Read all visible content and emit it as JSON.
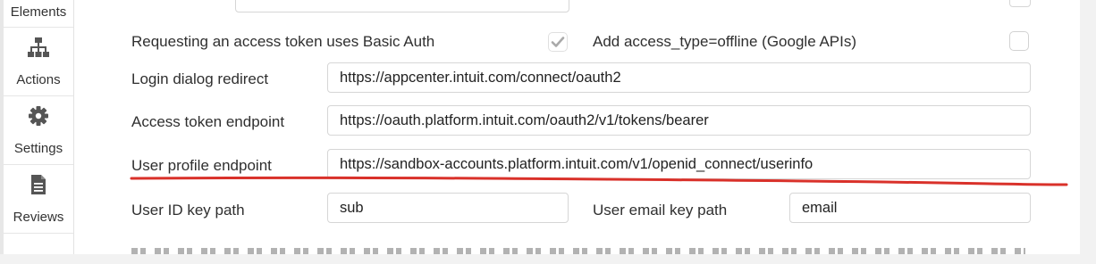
{
  "sidebar": {
    "items": [
      {
        "label": "Elements",
        "icon": "elements-icon"
      },
      {
        "label": "Actions",
        "icon": "sitemap-icon"
      },
      {
        "label": "Settings",
        "icon": "gear-icon"
      },
      {
        "label": "Reviews",
        "icon": "document-icon"
      }
    ]
  },
  "form": {
    "basic_auth_label": "Requesting an access token uses Basic Auth",
    "basic_auth_checked": true,
    "offline_label": "Add access_type=offline (Google APIs)",
    "offline_checked": false,
    "login_redirect_label": "Login dialog redirect",
    "login_redirect_value": "https://appcenter.intuit.com/connect/oauth2",
    "token_endpoint_label": "Access token endpoint",
    "token_endpoint_value": "https://oauth.platform.intuit.com/oauth2/v1/tokens/bearer",
    "profile_endpoint_label": "User profile endpoint",
    "profile_endpoint_value": "https://sandbox-accounts.platform.intuit.com/v1/openid_connect/userinfo",
    "user_id_label": "User ID key path",
    "user_id_value": "sub",
    "user_email_label": "User email key path",
    "user_email_value": "email"
  },
  "colors": {
    "annotation": "#d9312a",
    "checkmark": "#a9a9a9"
  }
}
